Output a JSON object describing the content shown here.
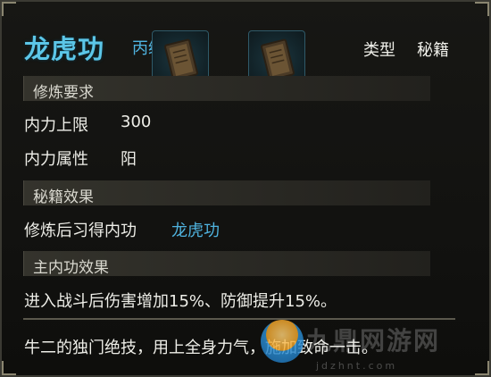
{
  "header": {
    "title": "龙虎功",
    "grade": "丙级",
    "type_label": "类型",
    "type_value": "秘籍"
  },
  "slots": [
    {
      "icon": "scroll-book-icon"
    },
    {
      "icon": "scroll-book-icon"
    }
  ],
  "requirements": {
    "section_label": "修炼要求",
    "rows": [
      {
        "label": "内力上限",
        "value": "300"
      },
      {
        "label": "内力属性",
        "value": "阳"
      }
    ]
  },
  "effect": {
    "section_label": "秘籍效果",
    "label": "修炼后习得内功",
    "value": "龙虎功"
  },
  "main_effect": {
    "section_label": "主内功效果",
    "text": "进入战斗后伤害增加15%、防御提升15%。"
  },
  "description": "牛二的独门绝技，用上全身力气，施加致命一击。",
  "watermark": {
    "text": "九鼎网游网",
    "url": "jdzhnt.com"
  },
  "colors": {
    "accent_blue": "#4fb3df",
    "title_blue": "#5cc6e8",
    "text": "#eeeee8",
    "background": "#121210"
  }
}
